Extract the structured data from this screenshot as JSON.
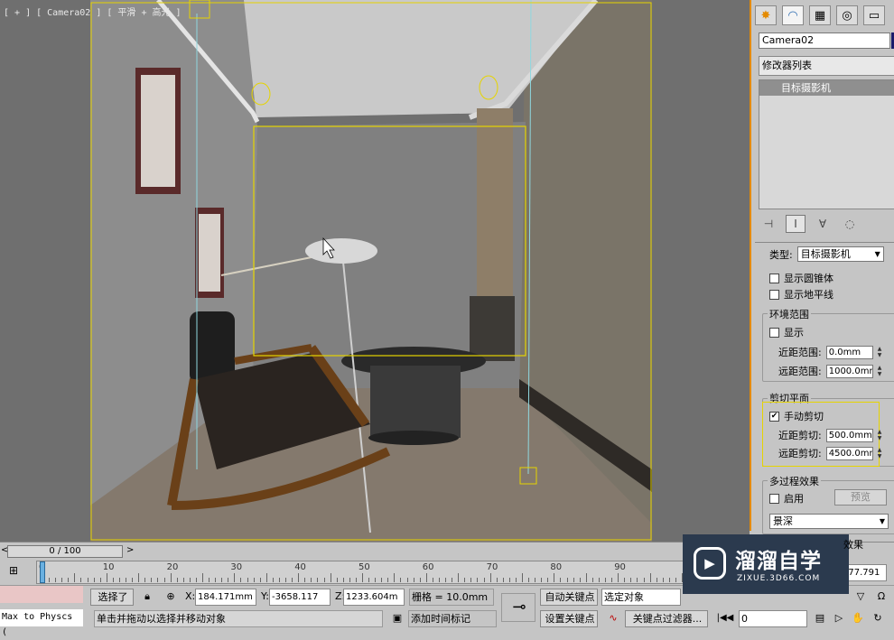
{
  "viewport": {
    "label": "[ + ] [ Camera02 ] [ 平滑 + 高光 ]"
  },
  "command_panel": {
    "tab_icons": [
      "create-icon",
      "modify-icon",
      "hierarchy-icon",
      "motion-icon",
      "display-icon"
    ],
    "object_name": "Camera02",
    "object_color": "#1a1a6a",
    "modifier_list": "修改器列表",
    "stack_item": "目标摄影机",
    "rollout": {
      "type_label": "类型:",
      "type_value": "目标摄影机",
      "show_cone": "显示圆锥体",
      "show_horizon": "显示地平线",
      "env_range_title": "环境范围",
      "env_show": "显示",
      "near_range_label": "近距范围:",
      "near_range_value": "0.0mm",
      "far_range_label": "远距范围:",
      "far_range_value": "1000.0mm",
      "clip_title": "剪切平面",
      "manual_clip": "手动剪切",
      "manual_clip_checked": "✔",
      "near_clip_label": "近距剪切:",
      "near_clip_value": "500.0mm",
      "far_clip_label": "远距剪切:",
      "far_clip_value": "4500.0mm",
      "multipass_title": "多过程效果",
      "enable": "启用",
      "preview": "预览",
      "effect": "景深",
      "effect_tail": "效果"
    }
  },
  "timeline": {
    "frame": "0 / 100",
    "prev": "<",
    "next": ">",
    "ticks": [
      "0",
      "10",
      "20",
      "30",
      "40",
      "50",
      "60",
      "70",
      "80",
      "90"
    ]
  },
  "statusbar": {
    "script_text": "Max to Physcs (",
    "selected": "选择了",
    "x_label": "X:",
    "x_value": "184.171mm",
    "y_label": "Y:",
    "y_value": "-3658.117",
    "z_label": "Z:",
    "z_value": "1233.604m",
    "grid": "栅格 = 10.0mm",
    "auto_key": "自动关键点",
    "selected_object": "选定对象",
    "set_key": "设置关键点",
    "key_filter": "关键点过滤器...",
    "prompt": "单击并拖动以选择并移动对象",
    "add_time_tag": "添加时间标记",
    "frame_field": "0",
    "right_value": "777.791"
  },
  "watermark": {
    "title": "溜溜自学",
    "url": "ZIXUE.3D66.COM"
  },
  "colors": {
    "selection": "#e6d400",
    "panel_accent": "#e48a00"
  }
}
